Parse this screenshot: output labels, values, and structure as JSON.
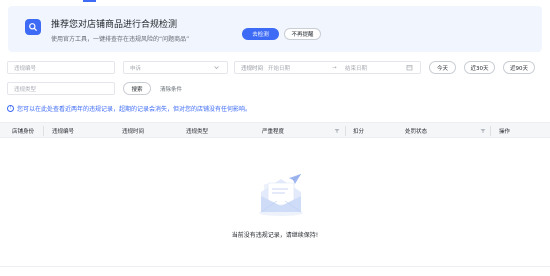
{
  "banner": {
    "title": "推荐您对店铺商品进行合规检测",
    "subtitle": "使用官方工具，一键排查存在违规风险的“问题商品”",
    "primary_button": "去检测",
    "secondary_button": "不再提醒"
  },
  "filters": {
    "violation_no_placeholder": "违规编号",
    "status_placeholder": "申诉",
    "time_label": "违规时间",
    "start_date_placeholder": "开始日期",
    "range_arrow": "→",
    "end_date_placeholder": "结束日期",
    "quick_today": "今天",
    "quick_30": "近30天",
    "quick_90": "近90天",
    "type_placeholder": "违规类型",
    "search_button": "搜索",
    "clear_button": "清除条件"
  },
  "notice": {
    "icon_glyph": "!",
    "text": "您可以在此处查看近两年的违规记录，超期的记录会消失，但对您的店铺没有任何影响。"
  },
  "table": {
    "headers": [
      "店铺身份",
      "违规编号",
      "违规时间",
      "违规类型",
      "严重程度",
      "扣分",
      "处罚状态",
      "操作"
    ]
  },
  "empty": {
    "text": "当前没有违规记录，请继续保持!"
  },
  "colors": {
    "accent": "#3d6bf5",
    "banner_bg": "#f1f5fd",
    "header_bg": "#f5f6f8"
  }
}
